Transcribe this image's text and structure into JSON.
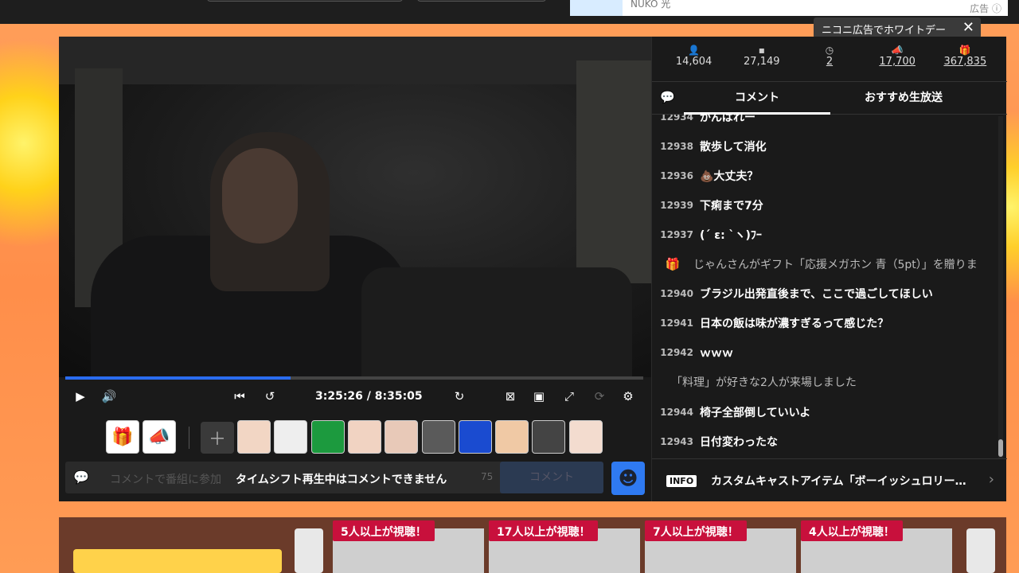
{
  "ad": {
    "text": "NUKO 光",
    "label": "広告"
  },
  "ad_note": {
    "text": "ニコニ広告でホワイトデー",
    "close": "✕"
  },
  "player": {
    "time": "3:25:26 / 8:35:05",
    "progress": 0.39,
    "comment_placeholder": "コメントで番組に参加",
    "comment_overlay": "タイムシフト再生中はコメントできません",
    "char_count": "75",
    "send_label": "コメント"
  },
  "gift_icons": [
    "gift-icon",
    "megaphone-icon"
  ],
  "emote_thumbs": [
    "emote-1",
    "emote-2",
    "emote-3",
    "emote-4",
    "emote-5",
    "emote-6",
    "emote-7",
    "emote-8",
    "emote-9",
    "emote-10"
  ],
  "stats": [
    {
      "icon": "person-icon",
      "value": "14,604"
    },
    {
      "icon": "comment-icon",
      "value": "27,149"
    },
    {
      "icon": "clock-icon",
      "value": "2"
    },
    {
      "icon": "megaphone-icon",
      "value": "17,700"
    },
    {
      "icon": "gift-icon",
      "value": "367,835"
    }
  ],
  "tabs": {
    "comments": "コメント",
    "recommended": "おすすめ生放送"
  },
  "comments": [
    {
      "no": "12934",
      "text": "がんばれー",
      "type": "normal"
    },
    {
      "no": "12938",
      "text": "散歩して消化",
      "type": "normal"
    },
    {
      "no": "12936",
      "text": "💩大丈夫？",
      "type": "normal"
    },
    {
      "no": "12939",
      "text": "下痢まで7分",
      "type": "normal"
    },
    {
      "no": "12937",
      "text": "(ˊ ε: `ヽ)ﾌｰ",
      "type": "normal"
    },
    {
      "no": "",
      "text": "じゃんさんがギフト「応援メガホン 青（5pt）」を贈りま",
      "type": "gift"
    },
    {
      "no": "12940",
      "text": "ブラジル出発直後まで、ここで過ごしてほしい",
      "type": "normal"
    },
    {
      "no": "12941",
      "text": "日本の飯は味が濃すぎるって感じた？",
      "type": "normal"
    },
    {
      "no": "12942",
      "text": "ｗｗｗ",
      "type": "normal"
    },
    {
      "no": "",
      "text": "「料理」が好きな2人が来場しました",
      "type": "sys"
    },
    {
      "no": "12944",
      "text": "椅子全部倒していいよ",
      "type": "normal"
    },
    {
      "no": "12943",
      "text": "日付変わったな",
      "type": "normal"
    }
  ],
  "info": {
    "badge": "INFO",
    "text": "カスタムキャストアイテム「ボーイッシュロリータ」"
  },
  "recs": [
    {
      "badge": "5人以上が視聴！"
    },
    {
      "badge": "17人以上が視聴！"
    },
    {
      "badge": "7人以上が視聴！"
    },
    {
      "badge": "4人以上が視聴！"
    }
  ]
}
